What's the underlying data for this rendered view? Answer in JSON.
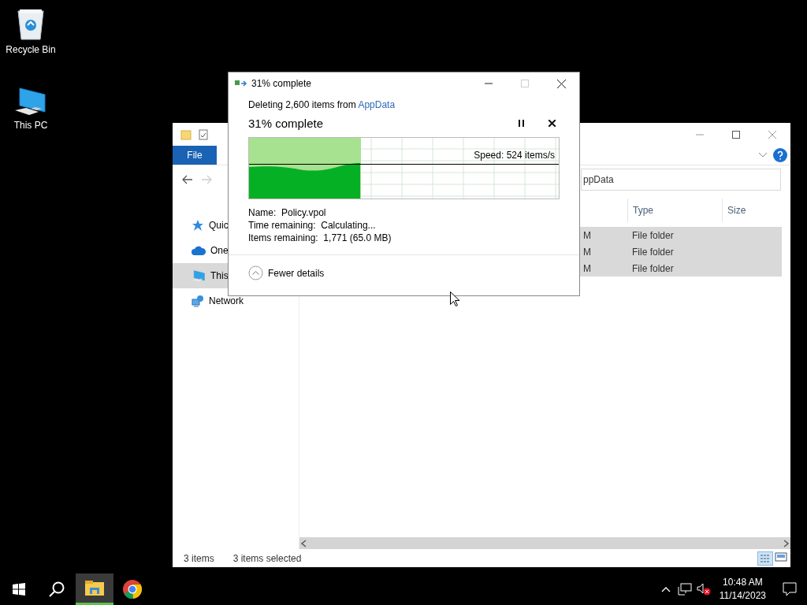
{
  "desktop": {
    "icons": [
      {
        "label": "Recycle Bin",
        "kind": "recycle"
      },
      {
        "label": "This PC",
        "kind": "computer"
      }
    ]
  },
  "explorer": {
    "file_tab": "File",
    "address": "ppData",
    "sidebar": {
      "items": [
        {
          "label": "Quic",
          "kind": "star",
          "selected": false
        },
        {
          "label": "One",
          "kind": "cloud",
          "selected": false
        },
        {
          "label": "This",
          "kind": "computer",
          "selected": true
        },
        {
          "label": "Network",
          "kind": "network",
          "selected": false
        }
      ]
    },
    "table": {
      "columns": [
        "Type",
        "Size"
      ],
      "rows": [
        {
          "column_1": "M",
          "type": "File folder",
          "selected": true
        },
        {
          "column_1": "M",
          "type": "File folder",
          "selected": true
        },
        {
          "column_1": "M",
          "type": "File folder",
          "selected": true
        }
      ]
    },
    "status_bar": {
      "item_count": "3 items",
      "selection": "3 items selected"
    }
  },
  "dialog": {
    "title": "31% complete",
    "subtitle": "Deleting 2,600 items from ",
    "source_link": "AppData",
    "heading": "31% complete",
    "progress": {
      "level": 0.36
    },
    "speed": "Speed: 524 items/s",
    "details": [
      "Name:  Policy.vpol",
      "Time remaining:  Calculating...",
      "Items remaining:  1,771 (65.0 MB)"
    ],
    "toggle": "Fewer details"
  },
  "taskbar": {
    "pinned": [
      {
        "kind": "explorer",
        "active": true
      },
      {
        "kind": "chrome",
        "active": false
      }
    ],
    "time": "10:48 AM",
    "date": "11/14/2023"
  }
}
